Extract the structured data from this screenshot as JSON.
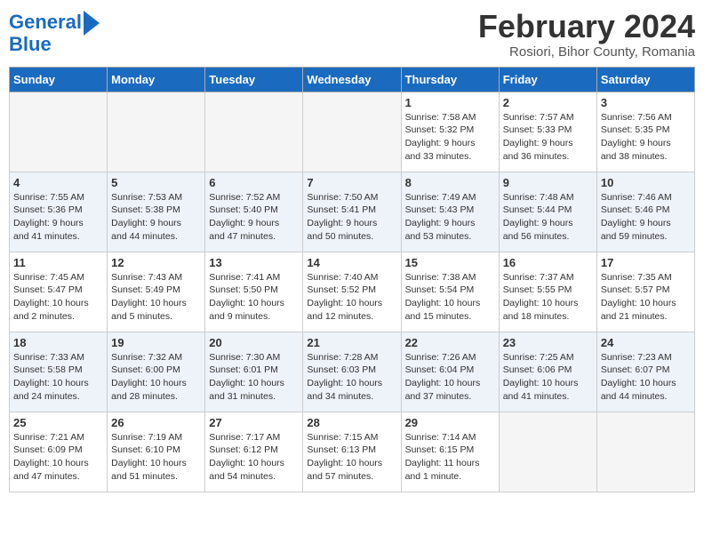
{
  "header": {
    "logo_line1": "General",
    "logo_line2": "Blue",
    "title": "February 2024",
    "subtitle": "Rosiori, Bihor County, Romania"
  },
  "weekdays": [
    "Sunday",
    "Monday",
    "Tuesday",
    "Wednesday",
    "Thursday",
    "Friday",
    "Saturday"
  ],
  "weeks": [
    [
      {
        "day": "",
        "info": ""
      },
      {
        "day": "",
        "info": ""
      },
      {
        "day": "",
        "info": ""
      },
      {
        "day": "",
        "info": ""
      },
      {
        "day": "1",
        "info": "Sunrise: 7:58 AM\nSunset: 5:32 PM\nDaylight: 9 hours\nand 33 minutes."
      },
      {
        "day": "2",
        "info": "Sunrise: 7:57 AM\nSunset: 5:33 PM\nDaylight: 9 hours\nand 36 minutes."
      },
      {
        "day": "3",
        "info": "Sunrise: 7:56 AM\nSunset: 5:35 PM\nDaylight: 9 hours\nand 38 minutes."
      }
    ],
    [
      {
        "day": "4",
        "info": "Sunrise: 7:55 AM\nSunset: 5:36 PM\nDaylight: 9 hours\nand 41 minutes."
      },
      {
        "day": "5",
        "info": "Sunrise: 7:53 AM\nSunset: 5:38 PM\nDaylight: 9 hours\nand 44 minutes."
      },
      {
        "day": "6",
        "info": "Sunrise: 7:52 AM\nSunset: 5:40 PM\nDaylight: 9 hours\nand 47 minutes."
      },
      {
        "day": "7",
        "info": "Sunrise: 7:50 AM\nSunset: 5:41 PM\nDaylight: 9 hours\nand 50 minutes."
      },
      {
        "day": "8",
        "info": "Sunrise: 7:49 AM\nSunset: 5:43 PM\nDaylight: 9 hours\nand 53 minutes."
      },
      {
        "day": "9",
        "info": "Sunrise: 7:48 AM\nSunset: 5:44 PM\nDaylight: 9 hours\nand 56 minutes."
      },
      {
        "day": "10",
        "info": "Sunrise: 7:46 AM\nSunset: 5:46 PM\nDaylight: 9 hours\nand 59 minutes."
      }
    ],
    [
      {
        "day": "11",
        "info": "Sunrise: 7:45 AM\nSunset: 5:47 PM\nDaylight: 10 hours\nand 2 minutes."
      },
      {
        "day": "12",
        "info": "Sunrise: 7:43 AM\nSunset: 5:49 PM\nDaylight: 10 hours\nand 5 minutes."
      },
      {
        "day": "13",
        "info": "Sunrise: 7:41 AM\nSunset: 5:50 PM\nDaylight: 10 hours\nand 9 minutes."
      },
      {
        "day": "14",
        "info": "Sunrise: 7:40 AM\nSunset: 5:52 PM\nDaylight: 10 hours\nand 12 minutes."
      },
      {
        "day": "15",
        "info": "Sunrise: 7:38 AM\nSunset: 5:54 PM\nDaylight: 10 hours\nand 15 minutes."
      },
      {
        "day": "16",
        "info": "Sunrise: 7:37 AM\nSunset: 5:55 PM\nDaylight: 10 hours\nand 18 minutes."
      },
      {
        "day": "17",
        "info": "Sunrise: 7:35 AM\nSunset: 5:57 PM\nDaylight: 10 hours\nand 21 minutes."
      }
    ],
    [
      {
        "day": "18",
        "info": "Sunrise: 7:33 AM\nSunset: 5:58 PM\nDaylight: 10 hours\nand 24 minutes."
      },
      {
        "day": "19",
        "info": "Sunrise: 7:32 AM\nSunset: 6:00 PM\nDaylight: 10 hours\nand 28 minutes."
      },
      {
        "day": "20",
        "info": "Sunrise: 7:30 AM\nSunset: 6:01 PM\nDaylight: 10 hours\nand 31 minutes."
      },
      {
        "day": "21",
        "info": "Sunrise: 7:28 AM\nSunset: 6:03 PM\nDaylight: 10 hours\nand 34 minutes."
      },
      {
        "day": "22",
        "info": "Sunrise: 7:26 AM\nSunset: 6:04 PM\nDaylight: 10 hours\nand 37 minutes."
      },
      {
        "day": "23",
        "info": "Sunrise: 7:25 AM\nSunset: 6:06 PM\nDaylight: 10 hours\nand 41 minutes."
      },
      {
        "day": "24",
        "info": "Sunrise: 7:23 AM\nSunset: 6:07 PM\nDaylight: 10 hours\nand 44 minutes."
      }
    ],
    [
      {
        "day": "25",
        "info": "Sunrise: 7:21 AM\nSunset: 6:09 PM\nDaylight: 10 hours\nand 47 minutes."
      },
      {
        "day": "26",
        "info": "Sunrise: 7:19 AM\nSunset: 6:10 PM\nDaylight: 10 hours\nand 51 minutes."
      },
      {
        "day": "27",
        "info": "Sunrise: 7:17 AM\nSunset: 6:12 PM\nDaylight: 10 hours\nand 54 minutes."
      },
      {
        "day": "28",
        "info": "Sunrise: 7:15 AM\nSunset: 6:13 PM\nDaylight: 10 hours\nand 57 minutes."
      },
      {
        "day": "29",
        "info": "Sunrise: 7:14 AM\nSunset: 6:15 PM\nDaylight: 11 hours\nand 1 minute."
      },
      {
        "day": "",
        "info": ""
      },
      {
        "day": "",
        "info": ""
      }
    ]
  ]
}
